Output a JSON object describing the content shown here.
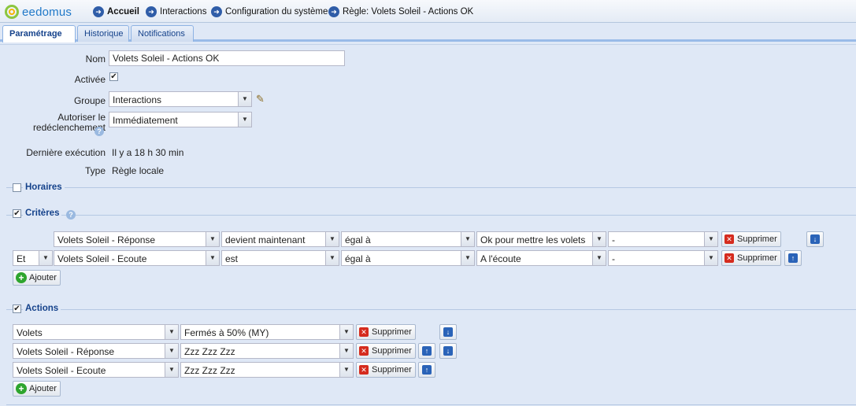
{
  "nav": {
    "logo": "eedomus",
    "crumbs": [
      "Accueil",
      "Interactions",
      "Configuration du système",
      "Règle: Volets Soleil - Actions OK"
    ]
  },
  "tabs": [
    "Paramétrage",
    "Historique",
    "Notifications"
  ],
  "form": {
    "nom_label": "Nom",
    "nom_value": "Volets Soleil - Actions OK",
    "activee_label": "Activée",
    "groupe_label": "Groupe",
    "groupe_value": "Interactions",
    "redecl_label_1": "Autoriser le",
    "redecl_label_2": "redéclenchement",
    "redecl_value": "Immédiatement",
    "derniere_label": "Dernière exécution",
    "derniere_value": "Il y a 18 h 30 min",
    "type_label": "Type",
    "type_value": "Règle locale"
  },
  "horaires": {
    "title": "Horaires"
  },
  "criteres": {
    "title": "Critères",
    "rows": [
      {
        "conj": "",
        "device": "Volets Soleil - Réponse",
        "cond": "devient maintenant",
        "op": "égal à",
        "value": "Ok pour mettre les volets",
        "extra": "-"
      },
      {
        "conj": "Et",
        "device": "Volets Soleil - Ecoute",
        "cond": "est",
        "op": "égal à",
        "value": "A l'écoute",
        "extra": "-"
      }
    ],
    "delete_label": "Supprimer",
    "add_label": "Ajouter"
  },
  "actions": {
    "title": "Actions",
    "rows": [
      {
        "device": "Volets",
        "value": "Fermés à 50% (MY)"
      },
      {
        "device": "Volets Soleil - Réponse",
        "value": "Zzz Zzz Zzz"
      },
      {
        "device": "Volets Soleil - Ecoute",
        "value": "Zzz Zzz Zzz"
      }
    ],
    "delete_label": "Supprimer",
    "add_label": "Ajouter"
  }
}
